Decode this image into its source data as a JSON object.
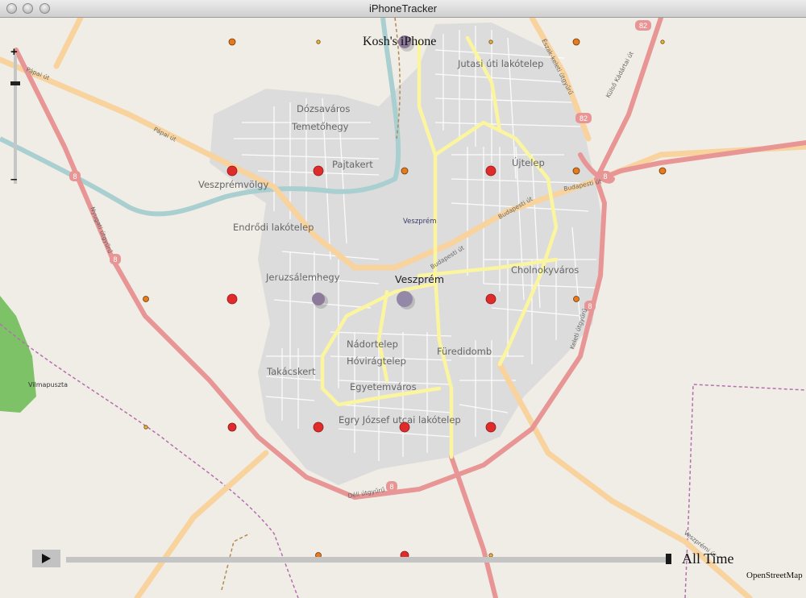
{
  "window": {
    "title": "iPhoneTracker"
  },
  "map": {
    "city": "Veszprém",
    "city_small": "Veszprém",
    "districts": [
      "Dózsaváros",
      "Temetőhegy",
      "Pajtakert",
      "Veszprémvölgy",
      "Endrődi lakótelep",
      "Jutasi úti lakótelep",
      "Újtelep",
      "Cholnokyváros",
      "Jeruzsálemhegy",
      "Nádortelep",
      "Hóvirágtelep",
      "Füredidomb",
      "Takácskert",
      "Egyetemváros",
      "Egry József utcai lakótelep",
      "Vilmapuszta"
    ],
    "roads": [
      "Pápai út",
      "Pápai út",
      "Budapesti út",
      "Budapesti út",
      "Budapesti út",
      "Nyugati útgyűrű",
      "Észak-keleti útgyűrű",
      "Külső Kádártai út",
      "Keleti útgyűrű",
      "Déli útgyűrű",
      "Veszprémi út"
    ],
    "road_numbers": [
      "82",
      "82",
      "8",
      "8",
      "8",
      "8",
      "8"
    ]
  },
  "device_label": "Kosh's iPhone",
  "controls": {
    "zoom_in_icon": "+",
    "zoom_out_icon": "–",
    "zoom_level": 0.78,
    "play_icon": "play-icon",
    "time_label": "All Time",
    "timeline_position": 1.0
  },
  "attribution": "OpenStreetMap",
  "colors": {
    "marker_red": "#e02b2b",
    "marker_orange": "#e57a1e",
    "marker_purple": "#8b7a9a",
    "motorway": "#e89595",
    "primary": "#f8d39e",
    "secondary": "#fbf5a0",
    "urban": "#dcdcdc",
    "river": "#a9cfd0"
  }
}
